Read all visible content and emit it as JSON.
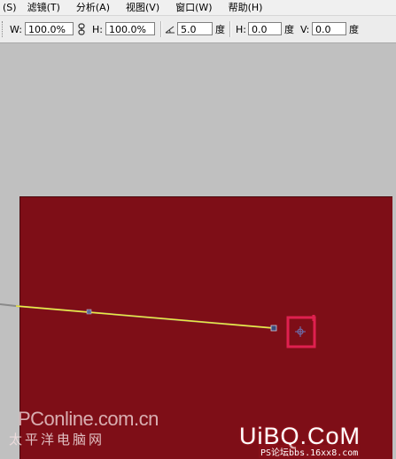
{
  "menubar": {
    "items": [
      "(S)",
      "滤镜(T)",
      "分析(A)",
      "视图(V)",
      "窗口(W)",
      "帮助(H)"
    ]
  },
  "options": {
    "w_label": "W:",
    "w_value": "100.0%",
    "h_label": "H:",
    "h_value": "100.0%",
    "rotate_value": "5.0",
    "rotate_unit": "度",
    "skew_h_label": "H:",
    "skew_h_value": "0.0",
    "skew_h_unit": "度",
    "skew_v_label": "V:",
    "skew_v_value": "0.0",
    "skew_v_unit": "度"
  },
  "colors": {
    "canvas_bg": "#7e0e17",
    "workspace_bg": "#c0c0c0",
    "path_stroke": "#f1ea3a",
    "highlight_box": "#e0204f"
  },
  "icons": {
    "link": "chain-link-icon",
    "rotate": "angle-icon",
    "pivot": "crosshair-icon"
  },
  "watermarks": {
    "left_title": "PConline.com.cn",
    "left_sub": "太平洋电脑网",
    "right_brand": "UiBQ.CoM",
    "footer": "PS论坛bbs.16xx8.com"
  }
}
